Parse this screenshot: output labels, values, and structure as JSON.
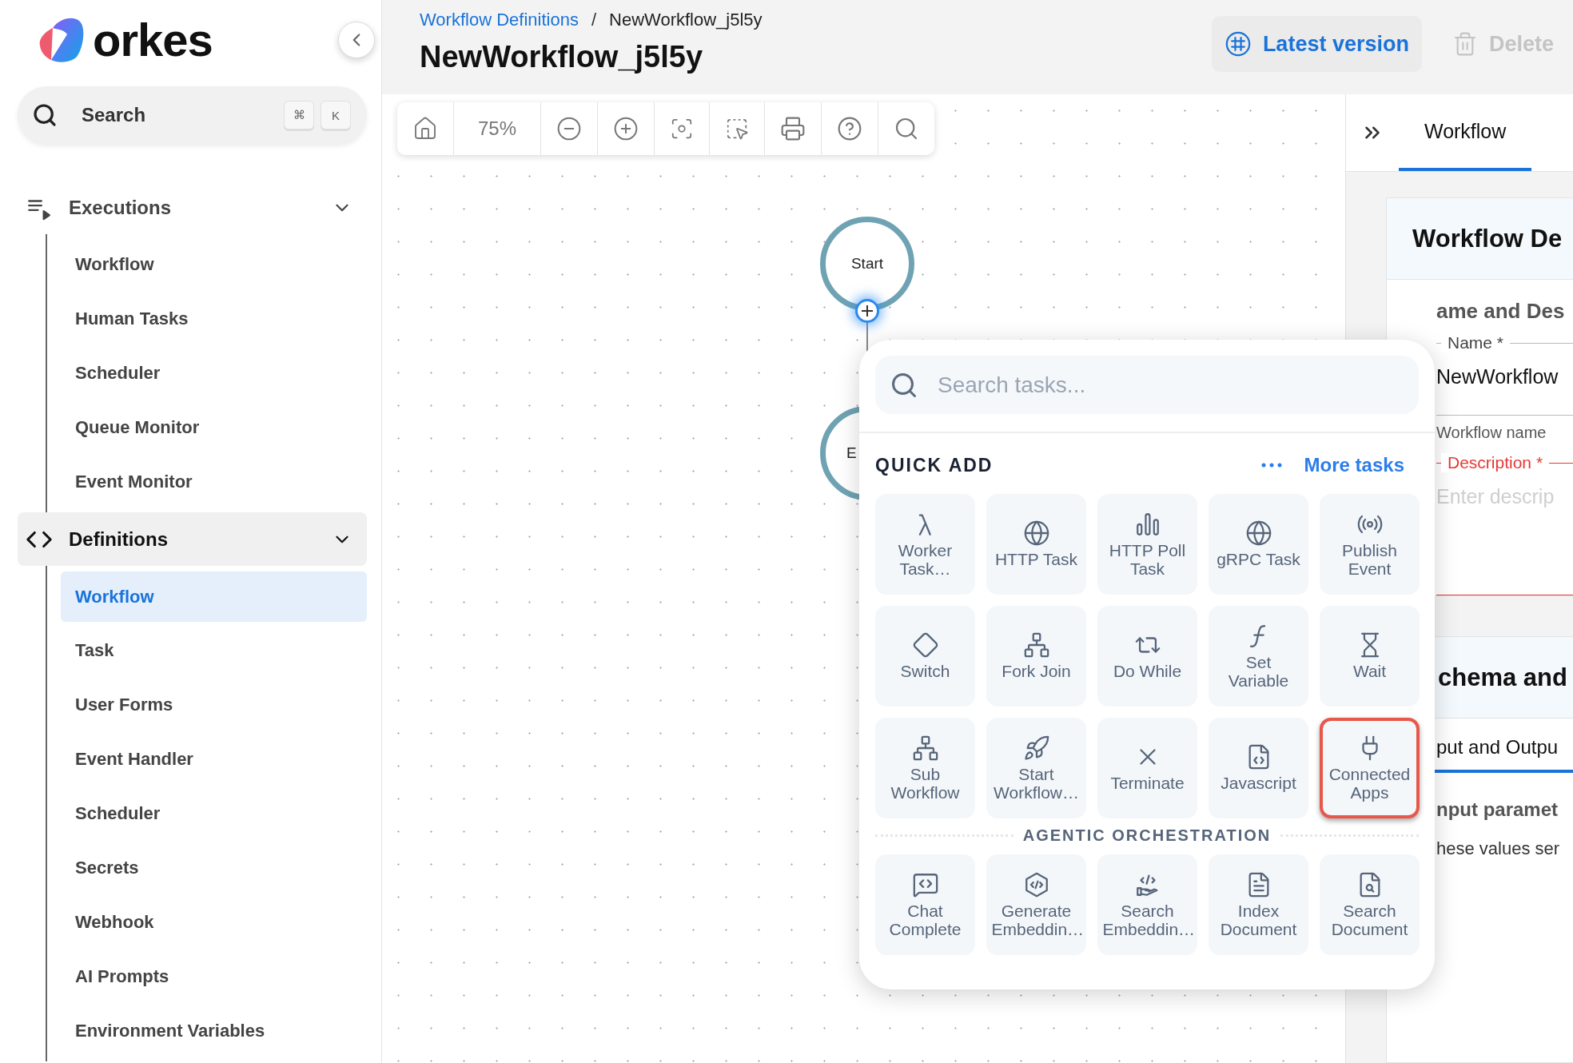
{
  "sidebar": {
    "logo": "orkes",
    "search": {
      "placeholder": "Search",
      "keys": [
        "⌘",
        "K"
      ]
    },
    "sections": [
      {
        "label": "Executions",
        "kind": "executions",
        "expanded": true,
        "selected": false,
        "children": [
          {
            "label": "Workflow",
            "selected": false
          },
          {
            "label": "Human Tasks",
            "selected": false
          },
          {
            "label": "Scheduler",
            "selected": false
          },
          {
            "label": "Queue Monitor",
            "selected": false
          },
          {
            "label": "Event Monitor",
            "selected": false
          }
        ]
      },
      {
        "label": "Definitions",
        "kind": "definitions",
        "expanded": true,
        "selected": true,
        "children": [
          {
            "label": "Workflow",
            "selected": true
          },
          {
            "label": "Task",
            "selected": false
          },
          {
            "label": "User Forms",
            "selected": false
          },
          {
            "label": "Event Handler",
            "selected": false
          },
          {
            "label": "Scheduler",
            "selected": false
          },
          {
            "label": "Secrets",
            "selected": false
          },
          {
            "label": "Webhook",
            "selected": false
          },
          {
            "label": "AI Prompts",
            "selected": false
          },
          {
            "label": "Environment Variables",
            "selected": false
          }
        ]
      }
    ]
  },
  "breadcrumb": [
    {
      "label": "Workflow Definitions",
      "kind": "link"
    },
    {
      "label": "/",
      "kind": "separator"
    },
    {
      "label": "NewWorkflow_j5l5y",
      "kind": "current"
    }
  ],
  "title": "NewWorkflow_j5l5y",
  "actions": [
    {
      "label": "Latest version",
      "kind": "version",
      "disabled": false
    },
    {
      "label": "Delete",
      "kind": "delete",
      "disabled": true
    }
  ],
  "toolbar": {
    "zoom": "75%"
  },
  "canvas": {
    "nodes": [
      {
        "label": "Start",
        "kind": "start"
      },
      {
        "label": "E",
        "kind": "end"
      }
    ]
  },
  "task_picker": {
    "placeholder": "Search tasks...",
    "title": "QUICK ADD",
    "more": "More tasks",
    "tasks": [
      {
        "label": "Worker Task…",
        "highlighted": false
      },
      {
        "label": "HTTP Task",
        "highlighted": false
      },
      {
        "label": "HTTP Poll Task",
        "highlighted": false
      },
      {
        "label": "gRPC Task",
        "highlighted": false
      },
      {
        "label": "Publish Event",
        "highlighted": false
      },
      {
        "label": "Switch",
        "highlighted": false
      },
      {
        "label": "Fork Join",
        "highlighted": false
      },
      {
        "label": "Do While",
        "highlighted": false
      },
      {
        "label": "Set Variable",
        "highlighted": false
      },
      {
        "label": "Wait",
        "highlighted": false
      },
      {
        "label": "Sub Workflow",
        "highlighted": false
      },
      {
        "label": "Start Workflow…",
        "highlighted": false
      },
      {
        "label": "Terminate",
        "highlighted": false
      },
      {
        "label": "Javascript",
        "highlighted": false
      },
      {
        "label": "Connected Apps",
        "highlighted": true
      }
    ],
    "section": "AGENTIC ORCHESTRATION",
    "agentic_tasks": [
      {
        "label": "Chat Complete",
        "highlighted": false
      },
      {
        "label": "Generate Embeddin…",
        "highlighted": false
      },
      {
        "label": "Search Embeddin…",
        "highlighted": false
      },
      {
        "label": "Index Document",
        "highlighted": false
      },
      {
        "label": "Search Document",
        "highlighted": false
      }
    ]
  },
  "right_panel": {
    "tab": "Workflow",
    "heading": "Workflow De",
    "section": "ame and Des",
    "name_field": {
      "label": "Name *",
      "value": "NewWorkflow",
      "helper": "Workflow name"
    },
    "description_field": {
      "label": "Description *",
      "placeholder": "Enter descrip",
      "error": true
    },
    "section2": "chema and",
    "subtab": "put and Outpu",
    "subheading": "nput paramet",
    "text": "hese values ser"
  }
}
